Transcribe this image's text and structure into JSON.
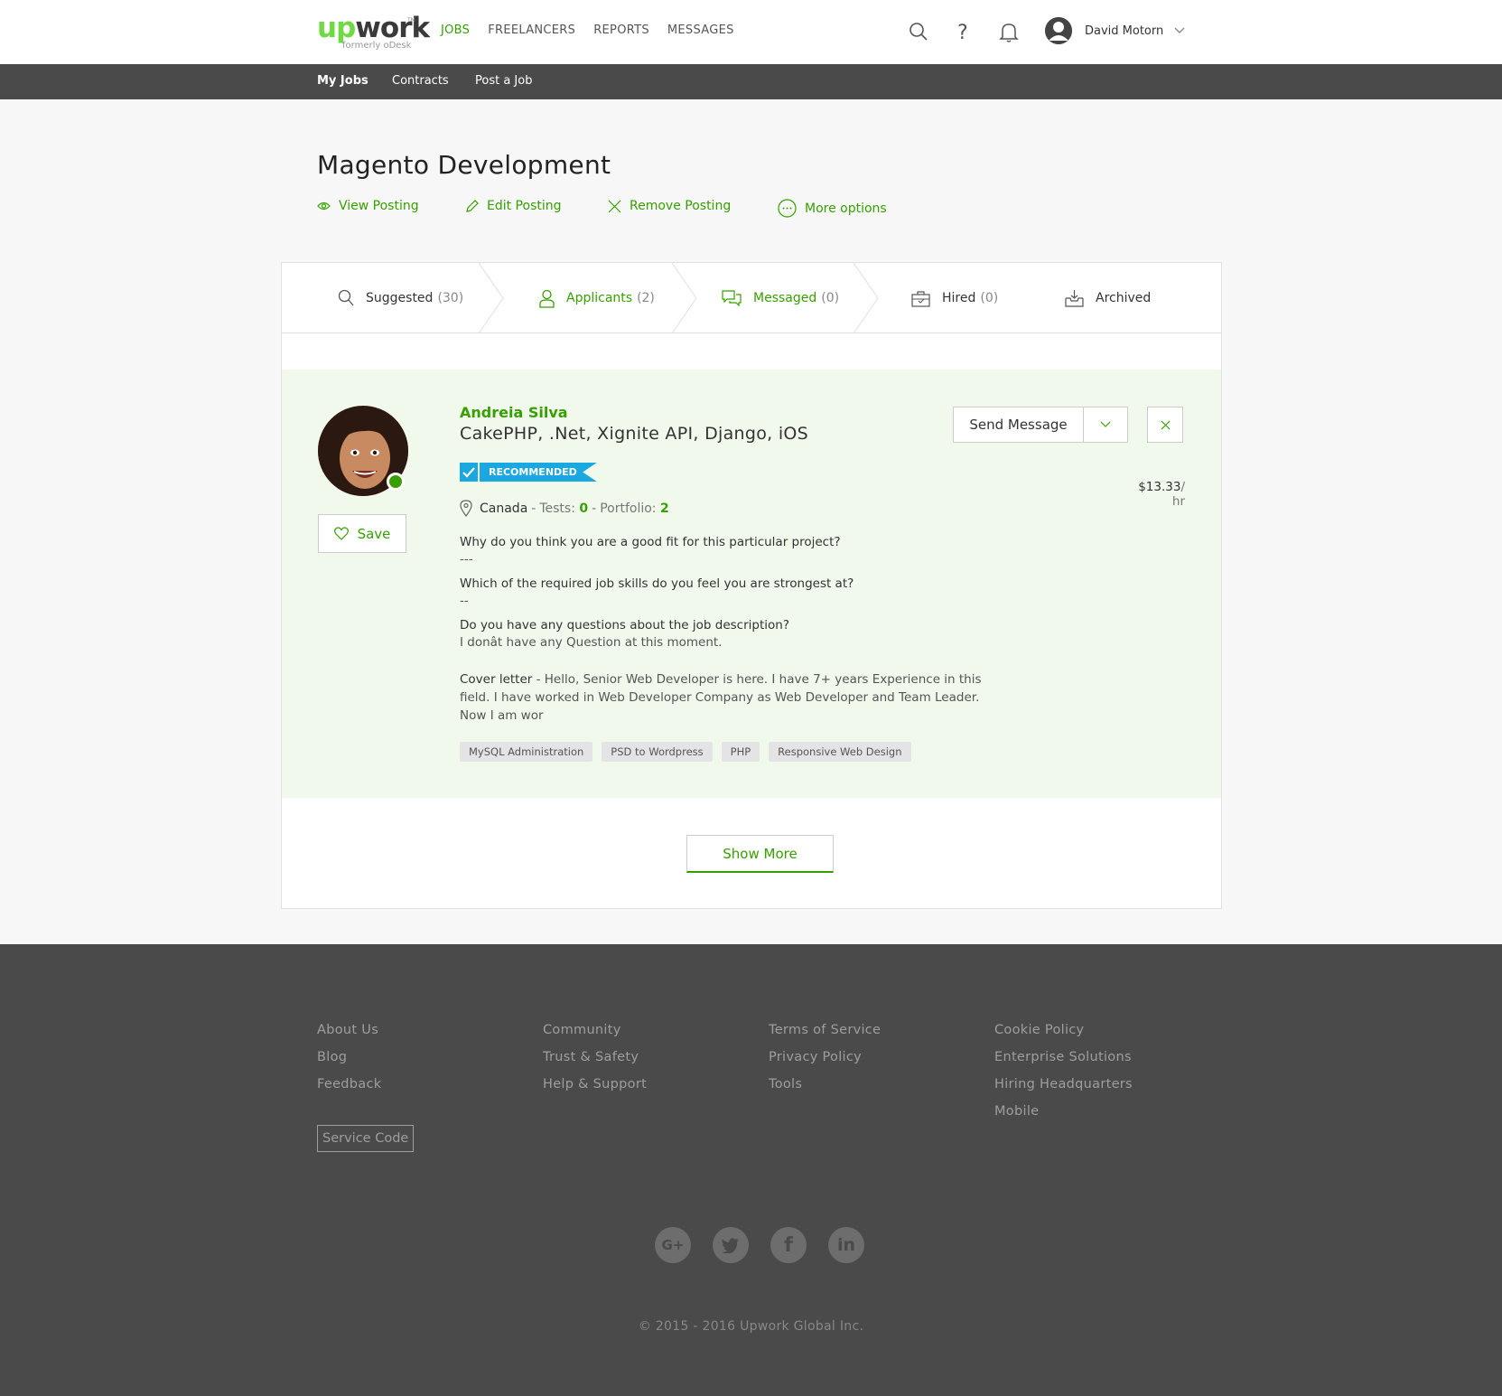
{
  "header": {
    "logo_up": "up",
    "logo_work": "work",
    "logo_tm": "TM",
    "logo_sub": "formerly oDesk",
    "nav": [
      "JOBS",
      "FREELANCERS",
      "REPORTS",
      "MESSAGES"
    ],
    "active_nav": "JOBS",
    "user_name": "David Motorn",
    "icons": [
      "search-icon",
      "help-icon",
      "bell-icon",
      "user-avatar-icon",
      "chevron-down-icon"
    ]
  },
  "subnav": [
    "My Jobs",
    "Contracts",
    "Post a Job"
  ],
  "page": {
    "title": "Magento Development",
    "actions": [
      "View Posting",
      "Edit Posting",
      "Remove Posting",
      "More options"
    ]
  },
  "tabs": [
    {
      "label": "Suggested",
      "count": "(30)"
    },
    {
      "label": "Applicants",
      "count": "(2)"
    },
    {
      "label": "Messaged",
      "count": "(0)"
    },
    {
      "label": "Hired",
      "count": "(0)"
    },
    {
      "label": "Archived",
      "count": ""
    }
  ],
  "applicant": {
    "name": "Andreia Silva",
    "title": "CakePHP, .Net, Xignite API, Django, iOS",
    "badge": "RECOMMENDED",
    "country": "Canada",
    "tests_label": "Tests:",
    "tests_value": "0",
    "portfolio_label": "Portfolio:",
    "portfolio_value": "2",
    "save_label": "Save",
    "send_message_label": "Send Message",
    "rate": "$13.33",
    "rate_unit": "/ hr",
    "questions": [
      {
        "q": "Why do you think you are a good fit for this particular project?",
        "a": "---"
      },
      {
        "q": "Which of the required job skills do you feel you are strongest at?",
        "a": "--"
      },
      {
        "q": "Do you have any questions about the job description?",
        "a": "I donât have any Question at this moment."
      }
    ],
    "cover_label": "Cover letter",
    "cover_text": " - Hello, Senior Web Developer is here. I have 7+ years Experience in this field. I have worked in Web Developer Company as Web Developer and Team Leader. Now I am wor",
    "tags": [
      "MySQL Administration",
      "PSD to Wordpress",
      "PHP",
      "Responsive Web Design"
    ]
  },
  "show_more_label": "Show More",
  "footer": {
    "col1": [
      "About Us",
      "Blog",
      "Feedback"
    ],
    "col2": [
      "Community",
      "Trust & Safety",
      "Help & Support"
    ],
    "col3": [
      "Terms of Service",
      "Privacy Policy",
      "Tools"
    ],
    "col4": [
      "Cookie Policy",
      "Enterprise Solutions",
      "Hiring Headquarters",
      "Mobile"
    ],
    "service_code": "Service Code",
    "social": [
      "google-plus-icon",
      "twitter-icon",
      "facebook-icon",
      "linkedin-icon"
    ],
    "copyright": "© 2015 - 2016 Upwork Global Inc."
  },
  "colors": {
    "accent": "#37a000",
    "badge": "#1ba7e0",
    "dark": "#4a4a4a",
    "applicant_bg": "#f1f8ec"
  }
}
